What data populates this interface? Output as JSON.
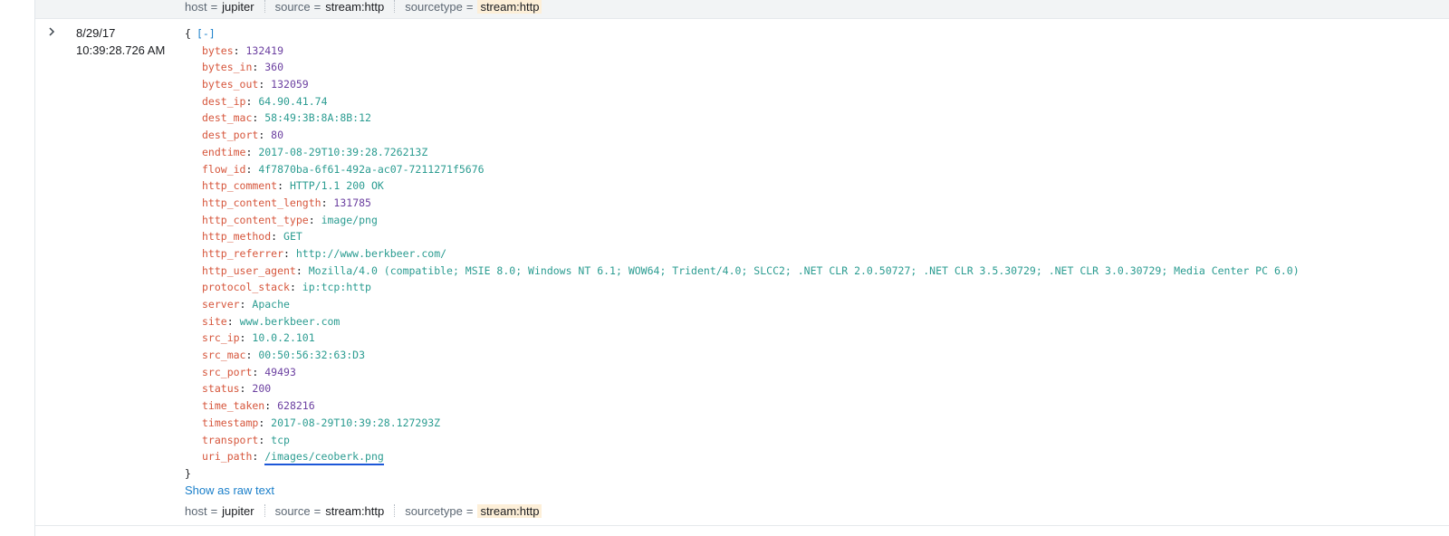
{
  "top_meta": [
    {
      "key": "host",
      "value": "jupiter",
      "highlight": false
    },
    {
      "key": "source",
      "value": "stream:http",
      "highlight": false
    },
    {
      "key": "sourcetype",
      "value": "stream:http",
      "highlight": true
    }
  ],
  "event": {
    "date": "8/29/17",
    "time": "10:39:28.726 AM",
    "expander_icon": "chevron-right-icon",
    "open_brace": "{",
    "collapse_label": "[-]",
    "close_brace": "}",
    "fields": [
      {
        "key": "bytes",
        "value": "132419",
        "type": "num"
      },
      {
        "key": "bytes_in",
        "value": "360",
        "type": "num"
      },
      {
        "key": "bytes_out",
        "value": "132059",
        "type": "num"
      },
      {
        "key": "dest_ip",
        "value": "64.90.41.74",
        "type": "str"
      },
      {
        "key": "dest_mac",
        "value": "58:49:3B:8A:8B:12",
        "type": "str"
      },
      {
        "key": "dest_port",
        "value": "80",
        "type": "num"
      },
      {
        "key": "endtime",
        "value": "2017-08-29T10:39:28.726213Z",
        "type": "str"
      },
      {
        "key": "flow_id",
        "value": "4f7870ba-6f61-492a-ac07-7211271f5676",
        "type": "str"
      },
      {
        "key": "http_comment",
        "value": "HTTP/1.1 200 OK",
        "type": "str"
      },
      {
        "key": "http_content_length",
        "value": "131785",
        "type": "num"
      },
      {
        "key": "http_content_type",
        "value": "image/png",
        "type": "str"
      },
      {
        "key": "http_method",
        "value": "GET",
        "type": "str"
      },
      {
        "key": "http_referrer",
        "value": "http://www.berkbeer.com/",
        "type": "str"
      },
      {
        "key": "http_user_agent",
        "value": "Mozilla/4.0 (compatible; MSIE 8.0; Windows NT 6.1; WOW64; Trident/4.0; SLCC2; .NET CLR 2.0.50727; .NET CLR 3.5.30729; .NET CLR 3.0.30729; Media Center PC 6.0)",
        "type": "str"
      },
      {
        "key": "protocol_stack",
        "value": "ip:tcp:http",
        "type": "str"
      },
      {
        "key": "server",
        "value": "Apache",
        "type": "str"
      },
      {
        "key": "site",
        "value": "www.berkbeer.com",
        "type": "str"
      },
      {
        "key": "src_ip",
        "value": "10.0.2.101",
        "type": "str"
      },
      {
        "key": "src_mac",
        "value": "00:50:56:32:63:D3",
        "type": "str"
      },
      {
        "key": "src_port",
        "value": "49493",
        "type": "num"
      },
      {
        "key": "status",
        "value": "200",
        "type": "num"
      },
      {
        "key": "time_taken",
        "value": "628216",
        "type": "num"
      },
      {
        "key": "timestamp",
        "value": "2017-08-29T10:39:28.127293Z",
        "type": "str"
      },
      {
        "key": "transport",
        "value": "tcp",
        "type": "str"
      },
      {
        "key": "uri_path",
        "value": "/images/ceoberk.png",
        "type": "sel"
      }
    ],
    "raw_text_link": "Show as raw text"
  },
  "bottom_meta": [
    {
      "key": "host",
      "value": "jupiter",
      "highlight": false
    },
    {
      "key": "source",
      "value": "stream:http",
      "highlight": false
    },
    {
      "key": "sourcetype",
      "value": "stream:http",
      "highlight": true
    }
  ],
  "colors": {
    "key": "#d6563c",
    "number": "#6b3fa0",
    "string": "#2b9c91",
    "link": "#1a7fca",
    "sourcetype_highlight": "#fdefd8",
    "selection_underline": "#1c57d8"
  }
}
